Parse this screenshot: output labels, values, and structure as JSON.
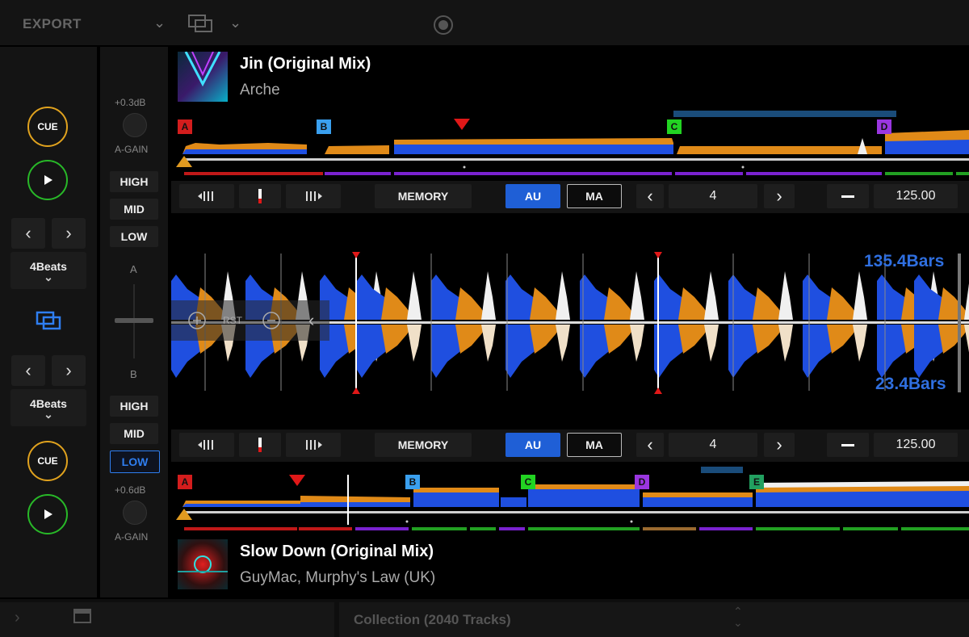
{
  "header": {
    "export_label": "EXPORT"
  },
  "deck1": {
    "title": "Jin (Original Mix)",
    "artist": "Arche",
    "cue_label": "CUE",
    "beat_jump": "4Beats",
    "gain_db": "+0.3dB",
    "gain_label": "A-GAIN",
    "eq": [
      "HIGH",
      "MID",
      "LOW"
    ],
    "channel_label": "A",
    "hot_cues": [
      "A",
      "B",
      "C",
      "D"
    ],
    "toolbar": {
      "memory_label": "MEMORY",
      "au_label": "AU",
      "ma_label": "MA",
      "loop_value": "4",
      "bpm_value": "125.00"
    },
    "bars_label": "135.4Bars"
  },
  "deck2": {
    "title": "Slow Down (Original Mix)",
    "artist": "GuyMac, Murphy's Law (UK)",
    "cue_label": "CUE",
    "beat_jump": "4Beats",
    "gain_db": "+0.6dB",
    "gain_label": "A-GAIN",
    "eq": [
      "HIGH",
      "MID",
      "LOW"
    ],
    "channel_label": "B",
    "hot_cues": [
      "A",
      "B",
      "C",
      "D",
      "E"
    ],
    "toolbar": {
      "memory_label": "MEMORY",
      "au_label": "AU",
      "ma_label": "MA",
      "loop_value": "4",
      "bpm_value": "125.00"
    },
    "bars_label": "23.4Bars"
  },
  "zoom": {
    "reset_label": "RST"
  },
  "browser": {
    "collection_label": "Collection (2040 Tracks)"
  },
  "colors": {
    "cue_orange": "#e0a21e",
    "play_green": "#28b828",
    "accent_blue": "#1f5fd6",
    "wave_blue": "#1f4fe0",
    "wave_orange": "#f0901a",
    "hotcue_a": "#d31d1d",
    "hotcue_b": "#3aa0ef",
    "hotcue_c": "#22d422",
    "hotcue_d": "#9a36e0",
    "hotcue_e": "#22a060"
  }
}
